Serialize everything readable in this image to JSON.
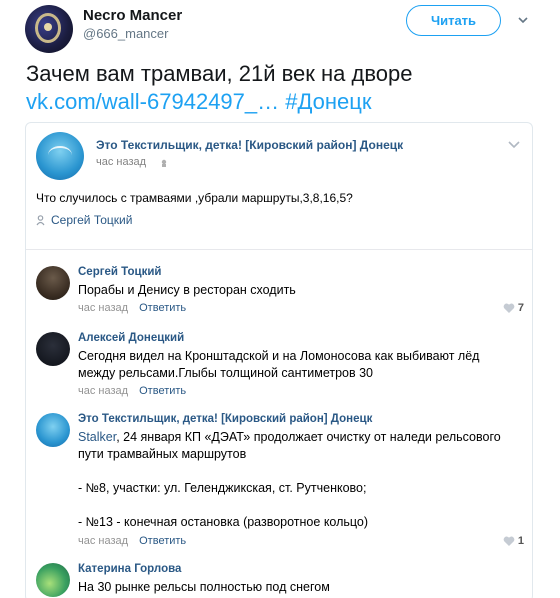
{
  "tweet": {
    "display_name": "Necro Mancer",
    "handle": "@666_mancer",
    "follow_label": "Читать",
    "text_line1": "Зачем вам трамваи, 21й век на дворе",
    "link_text": "vk.com/wall-67942497_…",
    "hashtag": "#Донецк"
  },
  "post": {
    "group_name": "Это Текстильщик, детка! [Кировский район] Донецк",
    "time": "час назад",
    "body": "Что случилось с трамваями ,убрали маршруты,3,8,16,5?",
    "author": "Сергей Тоцкий"
  },
  "comments": [
    {
      "name": "Сергей Тоцкий",
      "text": "Порабы и Денису в ресторан сходить",
      "time": "час назад",
      "reply": "Ответить",
      "likes": "7"
    },
    {
      "name": "Алексей Донецкий",
      "text": "Сегодня видел на Кронштадской и на Ломоносова как выбивают лёд между рельсами.Глыбы толщиной сантиметров 30",
      "time": "час назад",
      "reply": "Ответить",
      "likes": ""
    },
    {
      "name": "Это Текстильщик, детка! [Кировский район] Донецк",
      "text_link": "Stalker",
      "text_line1": ", 24 января КП «ДЭАТ» продолжает очистку от наледи рельсового",
      "text_line2": "пути трамвайных маршрутов",
      "text_line3": "- №8, участки: ул. Геленджикская, ст. Рутченково;",
      "text_line4": "- №13 - конечная остановка (разворотное кольцо)",
      "time": "час назад",
      "reply": "Ответить",
      "likes": "1"
    },
    {
      "name": "Катерина Горлова",
      "text": "На 30 рынке рельсы полностью под снегом"
    }
  ],
  "colors": {
    "twitter_blue": "#1da1f2",
    "vk_link": "#2a5885",
    "muted": "#939393"
  },
  "icons": [
    "chevron-down-icon",
    "eye-icon",
    "pin-icon",
    "heart-icon"
  ]
}
